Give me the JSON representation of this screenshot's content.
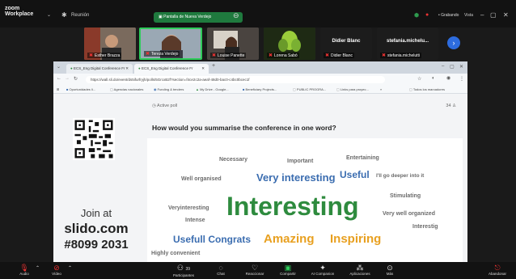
{
  "topbar": {
    "app_logo_line1": "zoom",
    "app_logo_line2": "Workplace",
    "meeting_label": "Reunión",
    "share_label": "Pantalla de Nueva Verdejo",
    "rec_label": "• Grabando",
    "view_label": "Vista"
  },
  "participants": [
    {
      "name": "Esther Brazza",
      "muted": true
    },
    {
      "name": "Tereza Verdejo",
      "muted": true
    },
    {
      "name": "Louise Panette",
      "muted": true
    },
    {
      "name": "Lorena Sabó",
      "muted": true
    },
    {
      "name": "Didier Blanc",
      "label": "Didier Blanc",
      "muted": true
    },
    {
      "name": "stefania.michelutti",
      "label": "stefania.michelu...",
      "muted": true
    }
  ],
  "browser": {
    "tabs": [
      {
        "label": "ECS_Eng Digital Conference Fr"
      },
      {
        "label": "ECS_Eng Digital Conference Fr"
      }
    ],
    "url": "https://wall.sli.do/event/ds5ifurfryjh/polls/5GrcxB2f?section=f4ce2c2a-aeaf-48d0-bac0-c4bc0bcec1f",
    "bookmarks": [
      "Oportunidades li...",
      "Agencias nacionales",
      "Funding & tenders",
      "My Drive - Google...",
      "Beneficiary Projects...",
      "PUBLIC PROGRA...",
      "Links para proyec...",
      "Todos los marcadores"
    ]
  },
  "slido": {
    "join_label": "Join at",
    "site": "slido.com",
    "code": "#8099 2031",
    "poll_status": "Active poll",
    "votes": "34",
    "question": "How would you summarise the conference in one word?"
  },
  "cloud_words": [
    {
      "text": "Necessary",
      "color": "#6b6b6b"
    },
    {
      "text": "Important",
      "color": "#6b6b6b"
    },
    {
      "text": "Entertaining",
      "color": "#6b6b6b"
    },
    {
      "text": "Well organised",
      "color": "#6b6b6b"
    },
    {
      "text": "Very interesting",
      "color": "#3b6db0"
    },
    {
      "text": "Useful",
      "color": "#3b6db0"
    },
    {
      "text": "I'll go deeper into it",
      "color": "#6b6b6b"
    },
    {
      "text": "Stimulating",
      "color": "#6b6b6b"
    },
    {
      "text": "Veryinteresting",
      "color": "#6b6b6b"
    },
    {
      "text": "Interesting",
      "color": "#2e8b3e"
    },
    {
      "text": "Very well organized",
      "color": "#6b6b6b"
    },
    {
      "text": "Intense",
      "color": "#6b6b6b"
    },
    {
      "text": "Interestig",
      "color": "#6b6b6b"
    },
    {
      "text": "Usefull Congrats",
      "color": "#3b6db0"
    },
    {
      "text": "Amazing",
      "color": "#e8a020"
    },
    {
      "text": "Inspiring",
      "color": "#e8a020"
    },
    {
      "text": "Highly convenient",
      "color": "#6b6b6b"
    }
  ],
  "footer": {
    "audio": "Audio",
    "video": "Vídeo",
    "participants": "Participantes",
    "participants_count": "39",
    "chat": "Chat",
    "react": "Reaccionar",
    "share": "Compartir",
    "ai": "AI Companion",
    "apps": "Aplicaciones",
    "more": "Más",
    "leave": "Abandonar"
  },
  "colors": {
    "accent_green": "#2e8b3e",
    "accent_blue": "#3b6db0",
    "accent_orange": "#e8a020",
    "zoom_share_green": "#1f7a3e"
  }
}
